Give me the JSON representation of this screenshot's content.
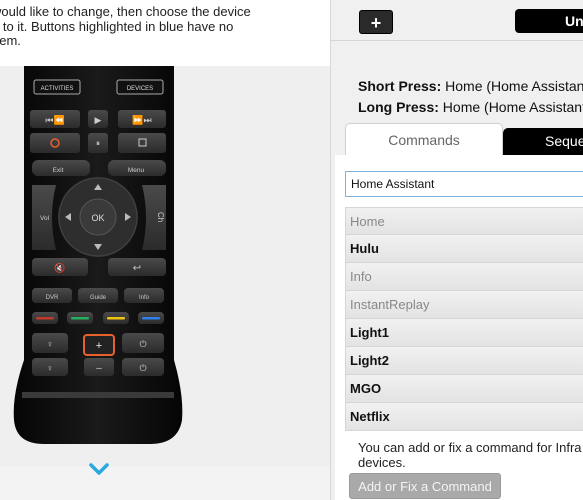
{
  "instructions": {
    "line1": "would like to change, then choose the device",
    "line2": "n to it. Buttons highlighted in blue have no",
    "line3": "hem."
  },
  "remote": {
    "activities_label": "ACTIVITIES",
    "devices_label": "DEVICES",
    "exit_label": "Exit",
    "menu_label": "Menu",
    "ok_label": "OK",
    "vol_label": "Vol",
    "ch_label": "Ch",
    "dvr_label": "DVR",
    "guide_label": "Guide",
    "info_label": "Info",
    "highlight_color": "#e8602c"
  },
  "toolbar": {
    "add_label": "+",
    "right_button_label": "Un"
  },
  "press": {
    "short_label": "Short Press:",
    "short_value": "Home (Home Assistant)",
    "long_label": "Long Press:",
    "long_value": "Home (Home Assistant)"
  },
  "tabs": {
    "commands": "Commands",
    "sequences": "Seque"
  },
  "command_input": {
    "value": "Home Assistant"
  },
  "commands": [
    {
      "label": "Home",
      "style": "gray"
    },
    {
      "label": "Hulu",
      "style": "bold"
    },
    {
      "label": "Info",
      "style": "gray"
    },
    {
      "label": "InstantReplay",
      "style": "gray"
    },
    {
      "label": "Light1",
      "style": "bold"
    },
    {
      "label": "Light2",
      "style": "bold"
    },
    {
      "label": "MGO",
      "style": "bold"
    },
    {
      "label": "Netflix",
      "style": "bold"
    }
  ],
  "help": {
    "line1": "You can add or fix a command for Infra",
    "line2": "devices."
  },
  "fix_button_label": "Add or Fix a Command",
  "colors": {
    "accent_blue": "#2aa8df",
    "remote_body": "#111111",
    "highlight_orange": "#e8602c"
  }
}
